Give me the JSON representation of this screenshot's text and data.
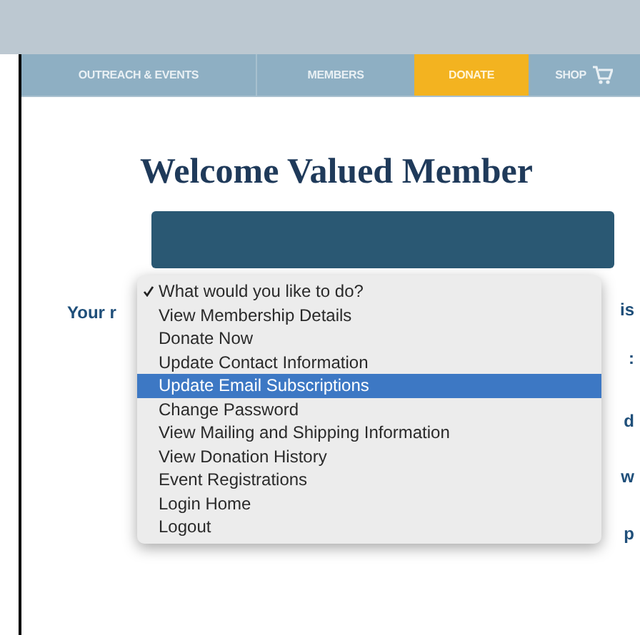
{
  "nav": [
    {
      "label": "OUTREACH & EVENTS",
      "selected": false,
      "kind": "link"
    },
    {
      "label": "MEMBERS",
      "selected": false,
      "kind": "link"
    },
    {
      "label": "DONATE",
      "selected": true,
      "kind": "link"
    },
    {
      "label": "SHOP",
      "selected": false,
      "kind": "cart"
    }
  ],
  "heading": "Welcome Valued Member",
  "behind_text": {
    "left": "Your r",
    "right": [
      "is",
      ":",
      "d",
      "w",
      "p"
    ]
  },
  "menu": {
    "items": [
      {
        "label": "What would you like to do?",
        "checked": true,
        "highlighted": false
      },
      {
        "label": "View Membership Details",
        "checked": false,
        "highlighted": false
      },
      {
        "label": "Donate Now",
        "checked": false,
        "highlighted": false
      },
      {
        "label": "Update Contact Information",
        "checked": false,
        "highlighted": false
      },
      {
        "label": "Update Email Subscriptions",
        "checked": false,
        "highlighted": true
      },
      {
        "label": "Change Password",
        "checked": false,
        "highlighted": false
      },
      {
        "label": "View Mailing and Shipping Information",
        "checked": false,
        "highlighted": false
      },
      {
        "label": "View Donation History",
        "checked": false,
        "highlighted": false
      },
      {
        "label": "Event Registrations",
        "checked": false,
        "highlighted": false
      },
      {
        "label": "Login Home",
        "checked": false,
        "highlighted": false
      },
      {
        "label": "Logout",
        "checked": false,
        "highlighted": false
      }
    ]
  }
}
